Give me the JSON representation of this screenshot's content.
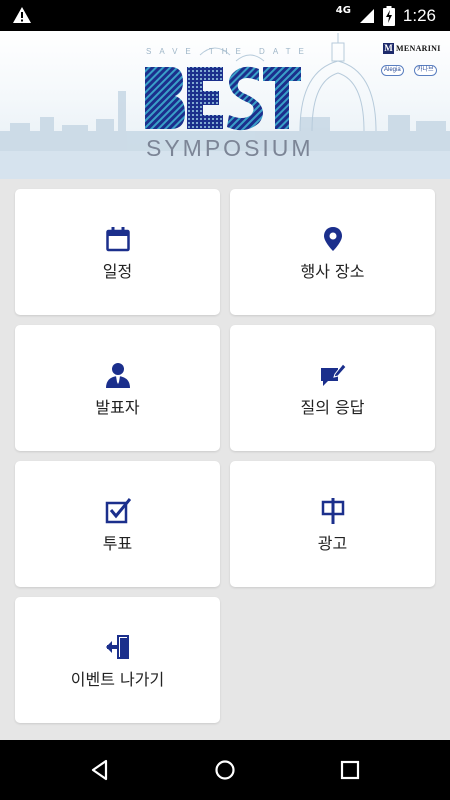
{
  "status_bar": {
    "network": "4G",
    "battery_level": "charging",
    "time": "1:26"
  },
  "banner": {
    "save_the_date": "SAVE THE DATE",
    "logo_text": "BEST",
    "subtitle": "SYMPOSIUM",
    "sponsors": [
      "MENARINI",
      "Alegia",
      "카나브"
    ]
  },
  "menu": {
    "items": [
      {
        "label": "일정",
        "icon": "calendar-icon"
      },
      {
        "label": "행사 장소",
        "icon": "location-pin-icon"
      },
      {
        "label": "발표자",
        "icon": "speaker-icon"
      },
      {
        "label": "질의 응답",
        "icon": "chat-edit-icon"
      },
      {
        "label": "투표",
        "icon": "checkbox-icon"
      },
      {
        "label": "광고",
        "icon": "signboard-icon"
      },
      {
        "label": "이벤트 나가기",
        "icon": "exit-door-icon"
      }
    ]
  },
  "colors": {
    "accent": "#1b2f8c",
    "background": "#e6e6e6",
    "tile": "#ffffff",
    "bars": "#000000"
  }
}
